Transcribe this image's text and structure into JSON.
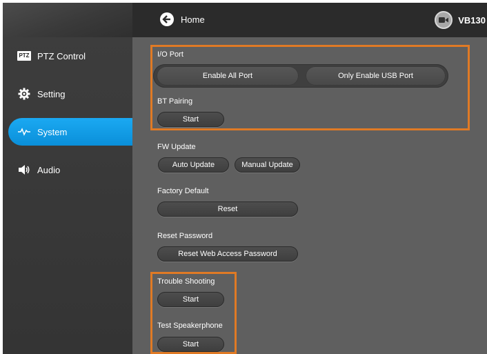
{
  "header": {
    "home_label": "Home",
    "device_name": "VB130"
  },
  "sidebar": {
    "items": [
      {
        "label": "PTZ Control",
        "badge": "PTZ",
        "icon": "ptz-badge-icon"
      },
      {
        "label": "Setting",
        "icon": "gear-icon"
      },
      {
        "label": "System",
        "icon": "pulse-icon",
        "active": true
      },
      {
        "label": "Audio",
        "icon": "speaker-icon"
      }
    ]
  },
  "main": {
    "io_port": {
      "title": "I/O Port",
      "enable_all": "Enable All Port",
      "only_usb": "Only Enable USB Port"
    },
    "bt_pairing": {
      "title": "BT Pairing",
      "button": "Start"
    },
    "fw_update": {
      "title": "FW Update",
      "auto": "Auto Update",
      "manual": "Manual Update"
    },
    "factory_default": {
      "title": "Factory Default",
      "button": "Reset"
    },
    "reset_password": {
      "title": "Reset Password",
      "button": "Reset Web Access Password"
    },
    "trouble_shooting": {
      "title": "Trouble Shooting",
      "button": "Start"
    },
    "test_speakerphone": {
      "title": "Test Speakerphone",
      "button": "Start"
    }
  },
  "colors": {
    "accent": "#0a98e6",
    "highlight_box": "#e07a25",
    "background": "#5f5f5f",
    "sidebar": "#383838",
    "header": "#2b2b2b"
  }
}
